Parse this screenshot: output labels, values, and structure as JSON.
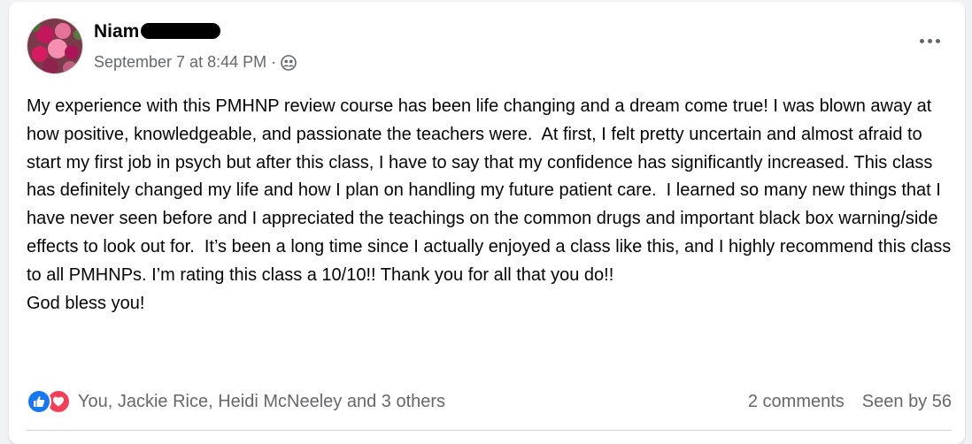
{
  "post": {
    "author_name": "Niam",
    "timestamp": "September 7 at 8:44 PM",
    "separator": "·",
    "audience_icon": "friends-icon",
    "more_icon": "ellipsis-icon",
    "body_text": "My experience with this PMHNP review course has been life changing and a dream come true! I was blown away at how positive, knowledgeable, and passionate the teachers were.  At first, I felt pretty uncertain and almost afraid to start my first job in psych but after this class, I have to say that my confidence has significantly increased. This class has definitely changed my life and how I plan on handling my future patient care.  I learned so many new things that I have never seen before and I appreciated the teachings on the common drugs and important black box warning/side effects to look out for.  It’s been a long time since I actually enjoyed a class like this, and I highly recommend this class to all PMHNPs. I’m rating this class a 10/10!! Thank you for all that you do!!\nGod bless you!"
  },
  "footer": {
    "reaction_icons": [
      "like-icon",
      "love-icon"
    ],
    "reactions_summary": "You, Jackie Rice, Heidi McNeeley and 3 others",
    "comments": "2 comments",
    "seen_by": "Seen by 56"
  },
  "colors": {
    "like": "#1877f2",
    "love": "#f33e58",
    "secondary_text": "#65676b",
    "primary_text": "#050505"
  }
}
